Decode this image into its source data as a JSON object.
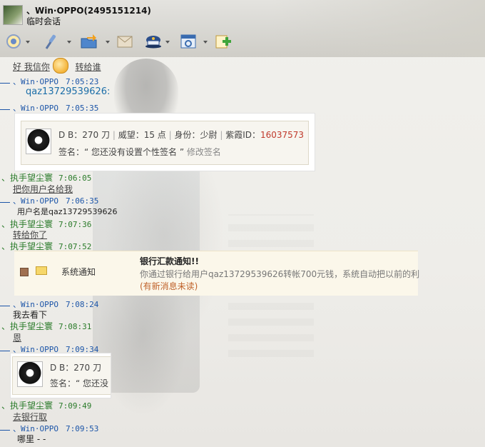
{
  "window": {
    "title": "、Win·OPPO(2495151214)",
    "subtitle": "临时会话"
  },
  "toolbar": {
    "buttons": [
      {
        "icon": "video-icon",
        "dropdown": true
      },
      {
        "icon": "voice-icon",
        "dropdown": true
      },
      {
        "icon": "folder-transfer-icon",
        "dropdown": true
      },
      {
        "icon": "mail-icon",
        "dropdown": false
      },
      {
        "icon": "police-hat-icon",
        "dropdown": true
      },
      {
        "icon": "app-window-icon",
        "dropdown": true
      },
      {
        "icon": "add-friend-icon",
        "dropdown": false
      }
    ]
  },
  "messages": {
    "m0_text_a": "好 我信你",
    "m0_text_b": "转给谁",
    "m1_sender": "、Win·OPPO",
    "m1_time": "7:05:23",
    "m1_text": "qaz13729539626:",
    "m2_sender": "、Win·OPPO",
    "m2_time": "7:05:35",
    "m3_sender": "、执手望尘寰",
    "m3_time": "7:06:05",
    "m3_text": "把你用户名给我",
    "m4_sender": "、Win·OPPO",
    "m4_time": "7:06:35",
    "m4_text": "用户名是qaz13729539626",
    "m5_sender": "、执手望尘寰",
    "m5_time": "7:07:36",
    "m5_text": "转给你了",
    "m6_sender": "、执手望尘寰",
    "m6_time": "7:07:52",
    "m7_sender": "、Win·OPPO",
    "m7_time": "7:08:24",
    "m7_text": "我去看下",
    "m8_sender": "、执手望尘寰",
    "m8_time": "7:08:31",
    "m8_text": "恩",
    "m9_sender": "、Win·OPPO",
    "m9_time": "7:09:34",
    "m10_sender": "、执手望尘寰",
    "m10_time": "7:09:49",
    "m10_text": "去银行取",
    "m11_sender": "、Win·OPPO",
    "m11_time": "7:09:53",
    "m11_text": "哪里 - -"
  },
  "profile_card": {
    "stats_a": "D B：270 刀",
    "stats_b": "威望：15 点",
    "stats_c": "身份：少尉",
    "stats_d_label": "紫霞ID：",
    "stats_d_value": "16037573",
    "sign_text": "签名：“ 您还没有设置个性签名 ”",
    "edit_sign": "修改签名",
    "partial_stats": "D B：270 刀",
    "partial_sign": "签名：“ 您还没"
  },
  "notice": {
    "label": "系统通知",
    "title": "银行汇款通知!!",
    "body": "你通过银行给用户qaz13729539626转帐700元钱，系统自动把以前的利",
    "unread": "(有新消息未读)"
  }
}
